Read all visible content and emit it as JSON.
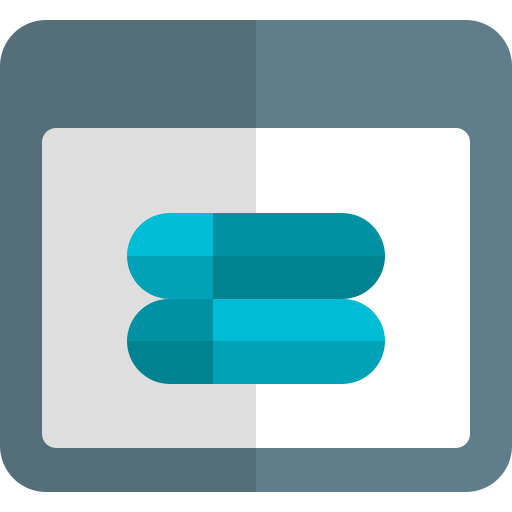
{
  "icon": {
    "name": "browser-window-toggle-icon",
    "colors": {
      "frame_dark": "#546E7A",
      "frame_light": "#607D8B",
      "content_left": "#DEDEDE",
      "content_right": "#FFFFFF",
      "pill_cyan": "#00BCD4",
      "pill_mid": "#00A2B7",
      "pill_dark": "#0092A3",
      "pill_darker": "#008290"
    }
  }
}
